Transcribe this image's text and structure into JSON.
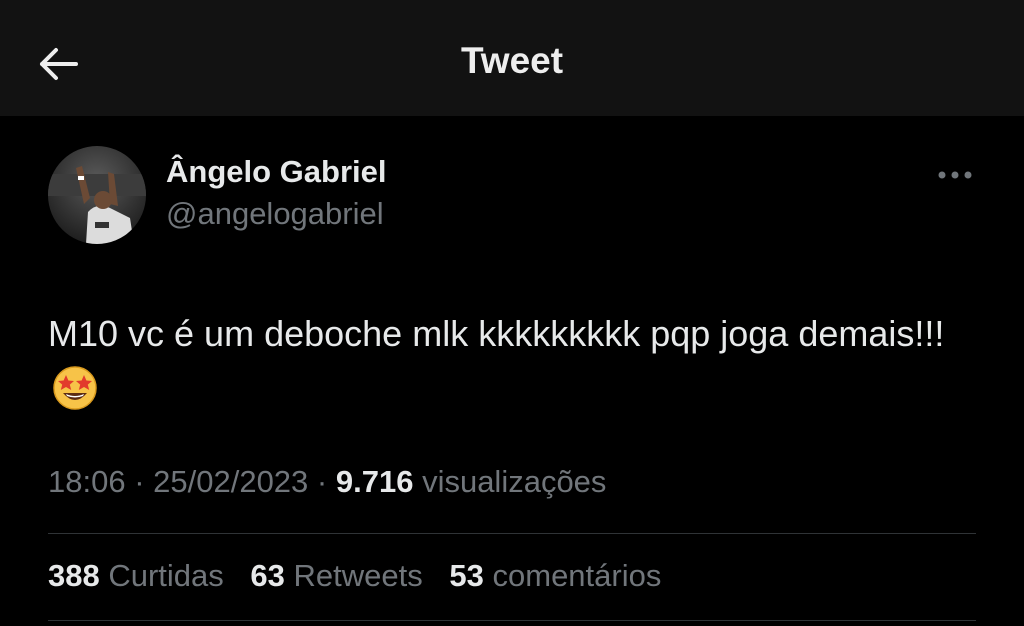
{
  "header": {
    "title": "Tweet",
    "back_icon": "arrow-left-icon"
  },
  "author": {
    "display_name": "Ângelo Gabriel",
    "handle": "@angelogabriel"
  },
  "tweet": {
    "text": "M10 vc é um deboche mlk kkkkkkkkk pqp joga demais!!!",
    "emoji_icon": "star-struck-emoji"
  },
  "meta": {
    "time": "18:06",
    "separator": " · ",
    "date": "25/02/2023",
    "views_count": "9.716",
    "views_label": "visualizações"
  },
  "stats": {
    "likes_count": "388",
    "likes_label": "Curtidas",
    "retweets_count": "63",
    "retweets_label": "Retweets",
    "comments_count": "53",
    "comments_label": "comentários"
  },
  "colors": {
    "background": "#000000",
    "topbar": "#121212",
    "primary_text": "#e7e9ea",
    "secondary_text": "#71767b",
    "divider": "#2f3336"
  }
}
